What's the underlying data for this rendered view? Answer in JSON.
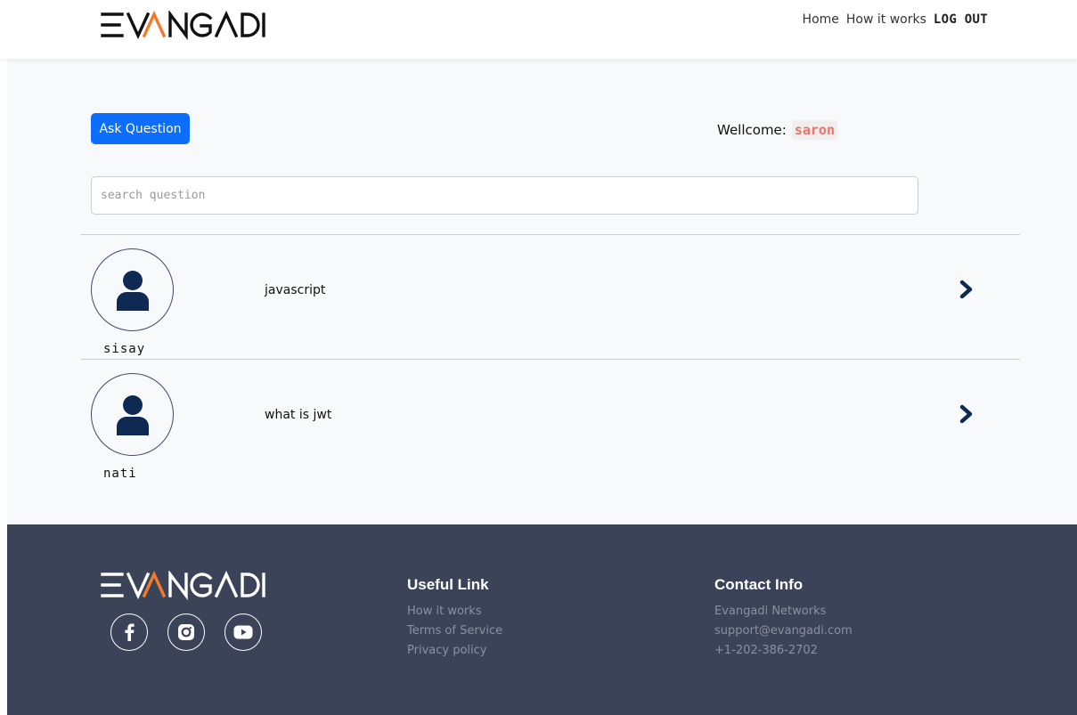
{
  "brand": {
    "logo": "EVANGADI"
  },
  "nav": {
    "home": "Home",
    "how_it_works": "How it works",
    "logout": "LOG OUT"
  },
  "main": {
    "ask_button": "Ask Question",
    "welcome_label": "Wellcome:",
    "username": "saron",
    "search_placeholder": "search question"
  },
  "questions": [
    {
      "user": "sisay",
      "title": "javascript"
    },
    {
      "user": "nati",
      "title": "what is jwt"
    }
  ],
  "footer": {
    "logo": "EVANGADI",
    "useful_title": "Useful Link",
    "useful_links": [
      "How it works",
      "Terms of Service",
      "Privacy policy"
    ],
    "contact_title": "Contact Info",
    "contact": [
      "Evangadi Networks",
      "support@evangadi.com",
      "+1-202-386-2702"
    ],
    "socials": [
      "facebook-icon",
      "instagram-icon",
      "youtube-icon"
    ]
  },
  "colors": {
    "primary": "#0d6efd",
    "footer_bg": "#3b4358",
    "accent_name": "#f0706a",
    "navy": "#0f2a52"
  }
}
